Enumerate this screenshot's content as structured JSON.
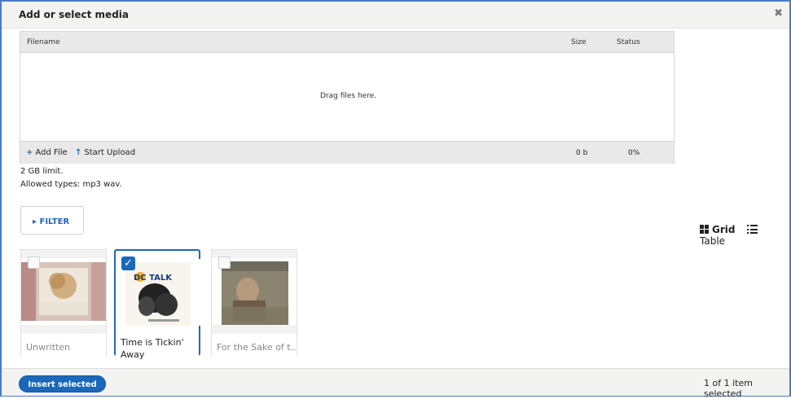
{
  "dialog": {
    "title": "Add or select media",
    "close_icon": "close-icon"
  },
  "uploader": {
    "columns": {
      "filename": "Filename",
      "size": "Size",
      "status": "Status"
    },
    "drop_text": "Drag files here.",
    "add_file": "Add File",
    "start_upload": "Start Upload",
    "total_size": "0 b",
    "total_percent": "0%"
  },
  "limits": {
    "size": "2 GB limit.",
    "types": "Allowed types: mp3 wav."
  },
  "filter": {
    "label": "▸ FILTER"
  },
  "views": {
    "grid": "Grid",
    "table": "Table",
    "active": "grid"
  },
  "media": [
    {
      "label": "Unwritten",
      "selected": false
    },
    {
      "label": "Time is Tickin' Away",
      "selected": true
    },
    {
      "label": "For the Sake of t...",
      "selected": false
    }
  ],
  "footer": {
    "insert_label": "Insert selected",
    "count_text": "1 of 1 item selected"
  },
  "colors": {
    "accent": "#1c68b8",
    "frame": "#4a7bc8"
  }
}
